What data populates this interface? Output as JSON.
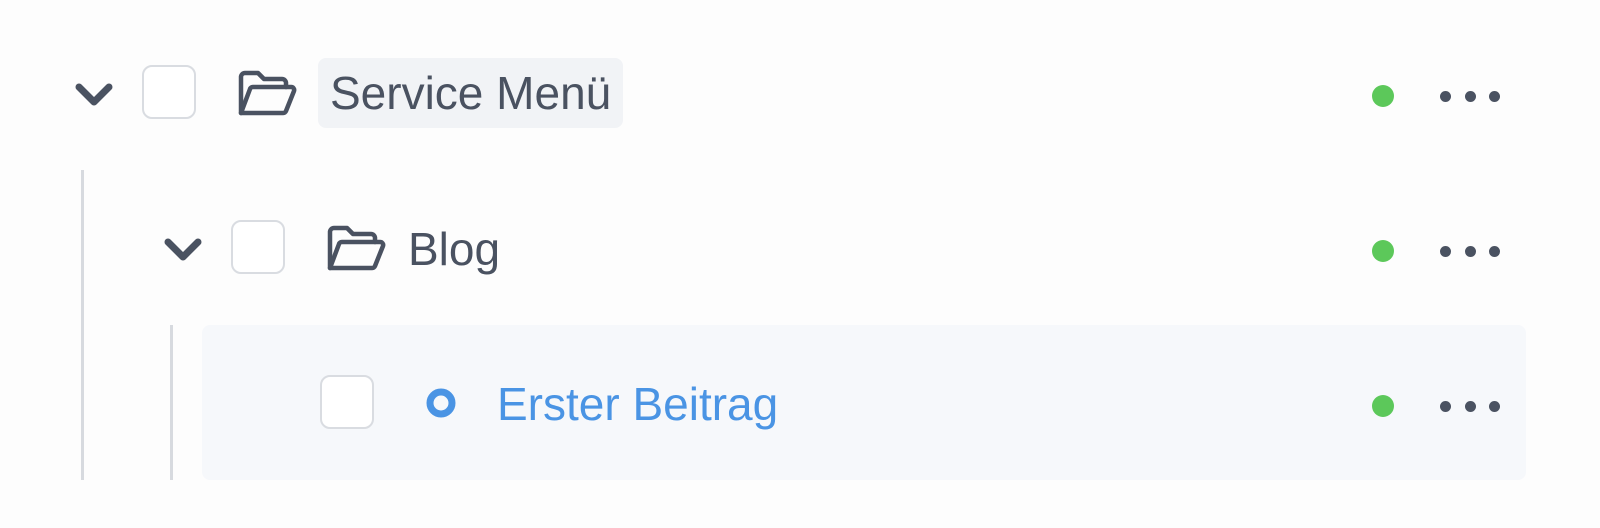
{
  "tree": {
    "items": [
      {
        "label": "Service Menü",
        "type": "folder",
        "expanded": true,
        "status": "online"
      },
      {
        "label": "Blog",
        "type": "folder",
        "expanded": true,
        "status": "online"
      },
      {
        "label": "Erster Beitrag",
        "type": "page",
        "status": "online"
      }
    ]
  },
  "icons": {
    "expand": "chevron-down-icon",
    "folder": "folder-open-icon",
    "page": "page-circle-icon",
    "more": "more-horizontal-icon"
  },
  "colors": {
    "status_online": "#5cc85a",
    "link": "#4a94e4",
    "text": "#4a5261",
    "guide_line": "#d7dadf"
  }
}
